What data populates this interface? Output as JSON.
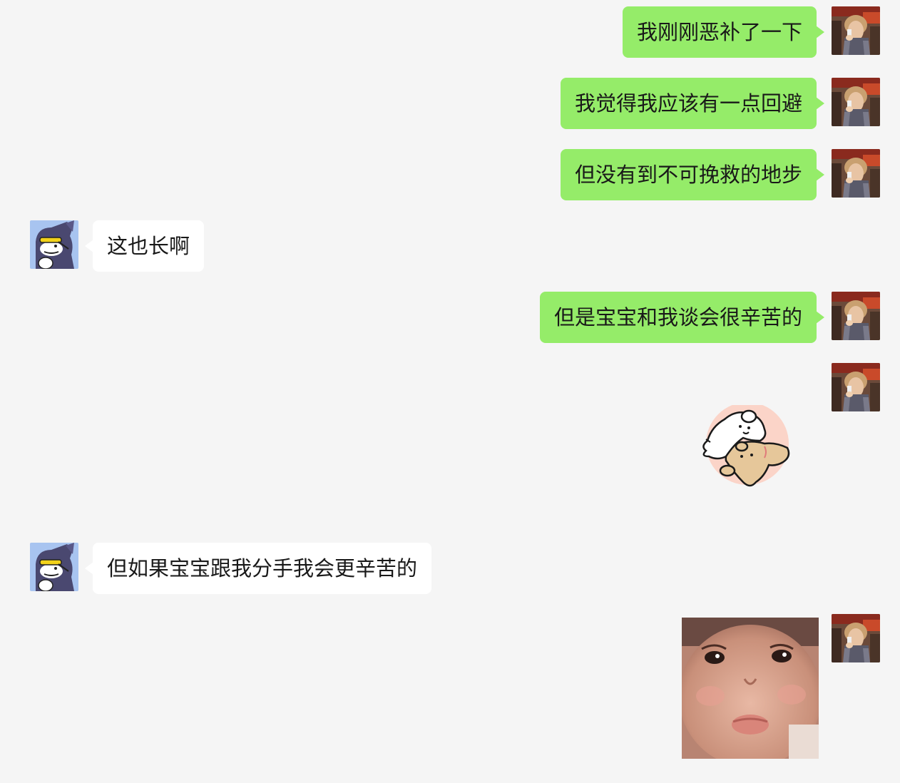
{
  "chat": {
    "messages": [
      {
        "sender": "me",
        "type": "text",
        "text": "我刚刚恶补了一下"
      },
      {
        "sender": "me",
        "type": "text",
        "text": "我觉得我应该有一点回避"
      },
      {
        "sender": "me",
        "type": "text",
        "text": "但没有到不可挽救的地步"
      },
      {
        "sender": "other",
        "type": "text",
        "text": "这也长啊"
      },
      {
        "sender": "me",
        "type": "text",
        "text": "但是宝宝和我谈会很辛苦的"
      },
      {
        "sender": "me",
        "type": "sticker",
        "sticker": "white-dog-hugging-bear-sticker"
      },
      {
        "sender": "other",
        "type": "text",
        "text": "但如果宝宝跟我分手我会更辛苦的"
      },
      {
        "sender": "me",
        "type": "image",
        "image": "crying-baby-photo"
      }
    ]
  },
  "colors": {
    "background": "#f5f5f5",
    "my_bubble": "#95ec69",
    "other_bubble": "#ffffff",
    "text": "#191919"
  },
  "avatars": {
    "me": "woman-on-phone-avatar",
    "other": "cartoon-cat-sunglasses-avatar"
  }
}
